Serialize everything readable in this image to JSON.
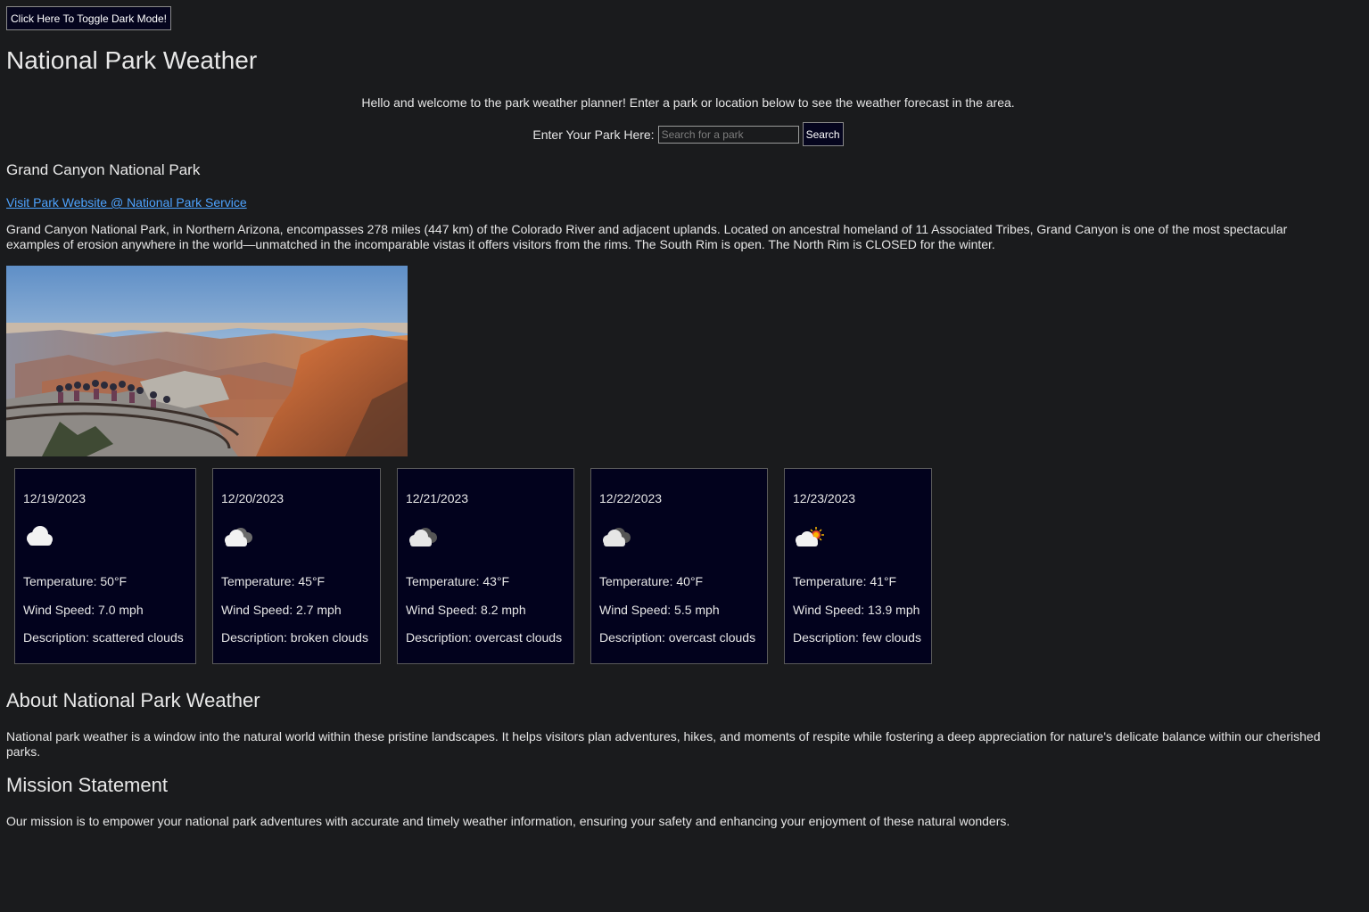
{
  "header": {
    "toggle_label": "Click Here To Toggle Dark Mode!",
    "title": "National Park Weather",
    "welcome": "Hello and welcome to the park weather planner! Enter a park or location below to see the weather forecast in the area."
  },
  "search": {
    "label": "Enter Your Park Here:",
    "placeholder": "Search for a park",
    "value": "",
    "button_label": "Search"
  },
  "park": {
    "name": "Grand Canyon National Park",
    "link_text": "Visit Park Website @ National Park Service",
    "description": "Grand Canyon National Park, in Northern Arizona, encompasses 278 miles (447 km) of the Colorado River and adjacent uplands. Located on ancestral homeland of 11 Associated Tribes, Grand Canyon is one of the most spectacular examples of erosion anywhere in the world—unmatched in the incomparable vistas it offers visitors from the rims. The South Rim is open. The North Rim is CLOSED for the winter."
  },
  "forecast": [
    {
      "date": "12/19/2023",
      "icon": "scattered-clouds-icon",
      "temp": "Temperature: 50°F",
      "wind": "Wind Speed: 7.0 mph",
      "desc": "Description: scattered clouds"
    },
    {
      "date": "12/20/2023",
      "icon": "broken-clouds-icon",
      "temp": "Temperature: 45°F",
      "wind": "Wind Speed: 2.7 mph",
      "desc": "Description: broken clouds"
    },
    {
      "date": "12/21/2023",
      "icon": "overcast-clouds-icon",
      "temp": "Temperature: 43°F",
      "wind": "Wind Speed: 8.2 mph",
      "desc": "Description: overcast clouds"
    },
    {
      "date": "12/22/2023",
      "icon": "overcast-clouds-icon",
      "temp": "Temperature: 40°F",
      "wind": "Wind Speed: 5.5 mph",
      "desc": "Description: overcast clouds"
    },
    {
      "date": "12/23/2023",
      "icon": "few-clouds-icon",
      "temp": "Temperature: 41°F",
      "wind": "Wind Speed: 13.9 mph",
      "desc": "Description: few clouds"
    }
  ],
  "about": {
    "title": "About National Park Weather",
    "text": "National park weather is a window into the natural world within these pristine landscapes. It helps visitors plan adventures, hikes, and moments of respite while fostering a deep appreciation for nature's delicate balance within our cherished parks."
  },
  "mission": {
    "title": "Mission Statement",
    "text": "Our mission is to empower your national park adventures with accurate and timely weather information, ensuring your safety and enhancing your enjoyment of these natural wonders."
  },
  "colors": {
    "background": "#1a1b1d",
    "card_background": "#02021d",
    "link": "#4da3ff",
    "button_background": "#05051e"
  }
}
